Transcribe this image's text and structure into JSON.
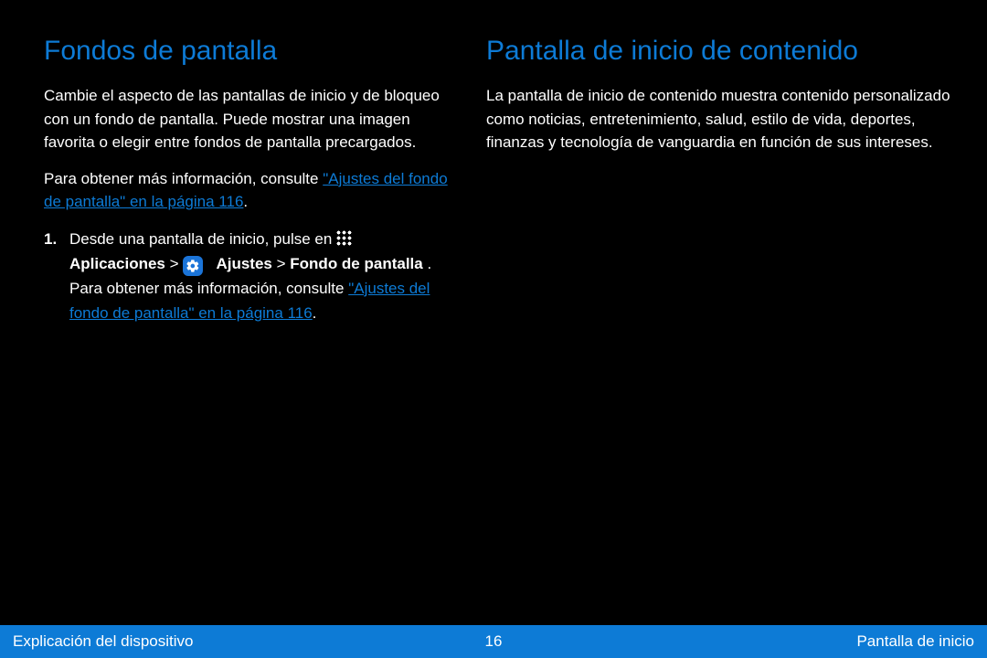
{
  "left": {
    "title": "Fondos de pantalla",
    "p1": "Cambie el aspecto de las pantallas de inicio y de bloqueo con un fondo de pantalla. Puede mostrar una imagen favorita o elegir entre fondos de pantalla precargados.",
    "p2_prefix": "Para obtener más información, consulte ",
    "p2_link": "\"Ajustes del fondo de pantalla\" en la página 116",
    "p2_suffix": ".",
    "steps": {
      "s1_num": "1.",
      "s1_prefix": "Desde una pantalla de inicio, pulse en ",
      "s1_apps_icon_label": "apps-grid-icon",
      "s1_apps_word": "Aplicaciones",
      "s1_middle": " > ",
      "s1_settings_icon_label": "settings-gear-icon",
      "s1_settings_word": "Ajustes",
      "s1_after": " > ",
      "s1_wallpaper": "Fondo de pantalla",
      "s1_end": ".",
      "s_more_prefix": "Para obtener más información, consulte ",
      "s_more_link": "\"Ajustes del fondo de pantalla\" en la página 116",
      "s_more_suffix": "."
    }
  },
  "right": {
    "title": "Pantalla de inicio de contenido",
    "p1": "La pantalla de inicio de contenido muestra contenido personalizado como noticias, entretenimiento, salud, estilo de vida, deportes, finanzas y tecnología de vanguardia en función de sus intereses."
  },
  "footer": {
    "left": "Explicación del dispositivo",
    "page": "16",
    "right": "Pantalla de inicio"
  }
}
